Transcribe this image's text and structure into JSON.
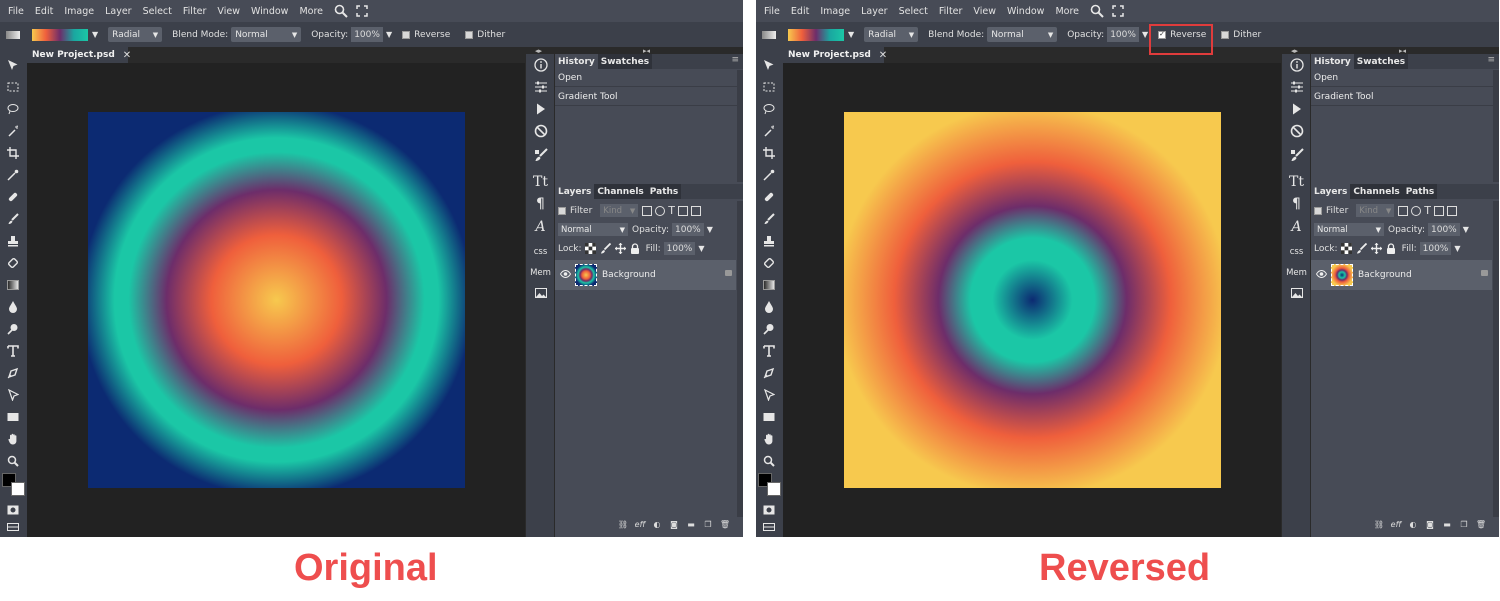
{
  "menu": [
    "File",
    "Edit",
    "Image",
    "Layer",
    "Select",
    "Filter",
    "View",
    "Window",
    "More"
  ],
  "menu_icons": [
    "search-icon",
    "fullscreen-icon"
  ],
  "options": {
    "gradient_type": "Radial",
    "blend_mode_label": "Blend Mode:",
    "blend_mode": "Normal",
    "opacity_label": "Opacity:",
    "opacity": "100%",
    "reverse_label": "Reverse",
    "dither_label": "Dither"
  },
  "document_tab": "New Project.psd",
  "history_panel": {
    "tabs": [
      "History",
      "Swatches"
    ],
    "items": [
      "Open",
      "Gradient Tool"
    ]
  },
  "layers_panel": {
    "tabs": [
      "Layers",
      "Channels",
      "Paths"
    ],
    "filter_label": "Filter",
    "kind_placeholder": "Kind",
    "blend_mode": "Normal",
    "opacity_label": "Opacity:",
    "opacity": "100%",
    "lock_label": "Lock:",
    "fill_label": "Fill:",
    "fill": "100%",
    "layer_name": "Background"
  },
  "side_panel_labels": [
    "css",
    "Mem"
  ],
  "panels": [
    {
      "reverse_checked": false,
      "caption": "Original"
    },
    {
      "reverse_checked": true,
      "caption": "Reversed"
    }
  ],
  "colors": {
    "accent_highlight": "#e03c3c",
    "caption": "#ee4e4e",
    "gradient_stops_original": [
      "#f7c94e",
      "#ef5f3c",
      "#6d2d6a",
      "#1bc7a6",
      "#0c2a72"
    ]
  }
}
